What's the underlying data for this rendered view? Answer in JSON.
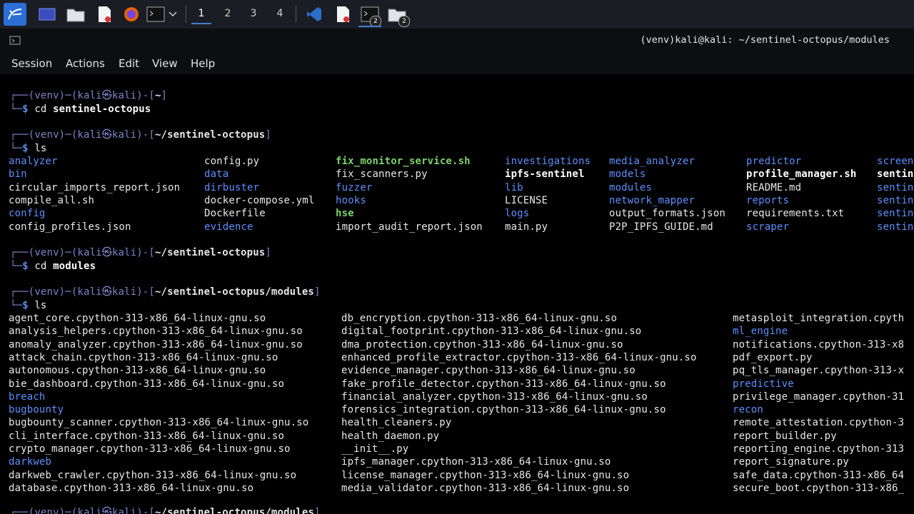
{
  "taskbar": {
    "workspaces": [
      "1",
      "2",
      "3",
      "4"
    ],
    "active_workspace": "1",
    "badge": "2"
  },
  "window": {
    "title": "(venv)kali@kali: ~/sentinel-octopus/modules"
  },
  "menu": [
    "Session",
    "Actions",
    "Edit",
    "View",
    "Help"
  ],
  "terminal": {
    "prompt_venv": "(venv)",
    "prompt_user": "kali",
    "prompt_host": "kali",
    "blocks": [
      {
        "path": "~",
        "cmd": "cd",
        "arg": "sentinel-octopus"
      },
      {
        "path": "~/sentinel-octopus",
        "cmd": "ls",
        "arg": ""
      },
      {
        "path": "~/sentinel-octopus",
        "cmd": "cd",
        "arg": "modules"
      },
      {
        "path": "~/sentinel-octopus/modules",
        "cmd": "ls",
        "arg": ""
      },
      {
        "path": "~/sentinel-octopus/modules",
        "cmd": "",
        "arg": ""
      }
    ],
    "ls_root_columns": [
      [
        {
          "name": "analyzer",
          "type": "dir"
        },
        {
          "name": "bin",
          "type": "dir"
        },
        {
          "name": "circular_imports_report.json",
          "type": "file"
        },
        {
          "name": "compile_all.sh",
          "type": "file"
        },
        {
          "name": "config",
          "type": "dir"
        },
        {
          "name": "config_profiles.json",
          "type": "file"
        }
      ],
      [
        {
          "name": "config.py",
          "type": "file"
        },
        {
          "name": "data",
          "type": "dir"
        },
        {
          "name": "dirbuster",
          "type": "dir"
        },
        {
          "name": "docker-compose.yml",
          "type": "file"
        },
        {
          "name": "Dockerfile",
          "type": "file"
        },
        {
          "name": "evidence",
          "type": "dir"
        }
      ],
      [
        {
          "name": "fix_monitor_service.sh",
          "type": "exec"
        },
        {
          "name": "fix_scanners.py",
          "type": "file"
        },
        {
          "name": "fuzzer",
          "type": "dir"
        },
        {
          "name": "hooks",
          "type": "dir"
        },
        {
          "name": "hse",
          "type": "exec"
        },
        {
          "name": "import_audit_report.json",
          "type": "file"
        }
      ],
      [
        {
          "name": "investigations",
          "type": "dir"
        },
        {
          "name": "ipfs-sentinel",
          "type": "bold"
        },
        {
          "name": "lib",
          "type": "dir"
        },
        {
          "name": "LICENSE",
          "type": "file"
        },
        {
          "name": "logs",
          "type": "dir"
        },
        {
          "name": "main.py",
          "type": "file"
        }
      ],
      [
        {
          "name": "media_analyzer",
          "type": "dir"
        },
        {
          "name": "models",
          "type": "dir"
        },
        {
          "name": "modules",
          "type": "dir"
        },
        {
          "name": "network_mapper",
          "type": "dir"
        },
        {
          "name": "output_formats.json",
          "type": "file"
        },
        {
          "name": "P2P_IPFS_GUIDE.md",
          "type": "file"
        }
      ],
      [
        {
          "name": "predictor",
          "type": "dir"
        },
        {
          "name": "profile_manager.sh",
          "type": "bold"
        },
        {
          "name": "README.md",
          "type": "file"
        },
        {
          "name": "reports",
          "type": "dir"
        },
        {
          "name": "requirements.txt",
          "type": "file"
        },
        {
          "name": "scraper",
          "type": "dir"
        }
      ],
      [
        {
          "name": "screen",
          "type": "dir"
        },
        {
          "name": "sentin",
          "type": "bold"
        },
        {
          "name": "sentin",
          "type": "dir"
        },
        {
          "name": "sentin",
          "type": "dir"
        },
        {
          "name": "sentin",
          "type": "dir"
        },
        {
          "name": "sentin",
          "type": "dir"
        }
      ]
    ],
    "ls_modules_columns": [
      [
        {
          "name": "agent_core.cpython-313-x86_64-linux-gnu.so",
          "type": "file"
        },
        {
          "name": "analysis_helpers.cpython-313-x86_64-linux-gnu.so",
          "type": "file"
        },
        {
          "name": "anomaly_analyzer.cpython-313-x86_64-linux-gnu.so",
          "type": "file"
        },
        {
          "name": "attack_chain.cpython-313-x86_64-linux-gnu.so",
          "type": "file"
        },
        {
          "name": "autonomous.cpython-313-x86_64-linux-gnu.so",
          "type": "file"
        },
        {
          "name": "bie_dashboard.cpython-313-x86_64-linux-gnu.so",
          "type": "file"
        },
        {
          "name": "breach",
          "type": "dir"
        },
        {
          "name": "bugbounty",
          "type": "dir"
        },
        {
          "name": "bugbounty_scanner.cpython-313-x86_64-linux-gnu.so",
          "type": "file"
        },
        {
          "name": "cli_interface.cpython-313-x86_64-linux-gnu.so",
          "type": "file"
        },
        {
          "name": "crypto_manager.cpython-313-x86_64-linux-gnu.so",
          "type": "file"
        },
        {
          "name": "darkweb",
          "type": "dir"
        },
        {
          "name": "darkweb_crawler.cpython-313-x86_64-linux-gnu.so",
          "type": "file"
        },
        {
          "name": "database.cpython-313-x86_64-linux-gnu.so",
          "type": "file"
        }
      ],
      [
        {
          "name": "db_encryption.cpython-313-x86_64-linux-gnu.so",
          "type": "file"
        },
        {
          "name": "digital_footprint.cpython-313-x86_64-linux-gnu.so",
          "type": "file"
        },
        {
          "name": "dma_protection.cpython-313-x86_64-linux-gnu.so",
          "type": "file"
        },
        {
          "name": "enhanced_profile_extractor.cpython-313-x86_64-linux-gnu.so",
          "type": "file"
        },
        {
          "name": "evidence_manager.cpython-313-x86_64-linux-gnu.so",
          "type": "file"
        },
        {
          "name": "fake_profile_detector.cpython-313-x86_64-linux-gnu.so",
          "type": "file"
        },
        {
          "name": "financial_analyzer.cpython-313-x86_64-linux-gnu.so",
          "type": "file"
        },
        {
          "name": "forensics_integration.cpython-313-x86_64-linux-gnu.so",
          "type": "file"
        },
        {
          "name": "health_cleaners.py",
          "type": "file"
        },
        {
          "name": "health_daemon.py",
          "type": "file"
        },
        {
          "name": "__init__.py",
          "type": "file"
        },
        {
          "name": "ipfs_manager.cpython-313-x86_64-linux-gnu.so",
          "type": "file"
        },
        {
          "name": "license_manager.cpython-313-x86_64-linux-gnu.so",
          "type": "file"
        },
        {
          "name": "media_validator.cpython-313-x86_64-linux-gnu.so",
          "type": "file"
        }
      ],
      [
        {
          "name": "metasploit_integration.cpyth",
          "type": "file"
        },
        {
          "name": "ml_engine",
          "type": "dir"
        },
        {
          "name": "notifications.cpython-313-x8",
          "type": "file"
        },
        {
          "name": "pdf_export.py",
          "type": "file"
        },
        {
          "name": "pq_tls_manager.cpython-313-x",
          "type": "file"
        },
        {
          "name": "predictive",
          "type": "dir"
        },
        {
          "name": "privilege_manager.cpython-31",
          "type": "file"
        },
        {
          "name": "recon",
          "type": "dir"
        },
        {
          "name": "remote_attestation.cpython-3",
          "type": "file"
        },
        {
          "name": "report_builder.py",
          "type": "file"
        },
        {
          "name": "reporting_engine.cpython-313",
          "type": "file"
        },
        {
          "name": "report_signature.py",
          "type": "file"
        },
        {
          "name": "safe_data.cpython-313-x86_64",
          "type": "file"
        },
        {
          "name": "secure_boot.cpython-313-x86_",
          "type": "file"
        }
      ]
    ]
  }
}
